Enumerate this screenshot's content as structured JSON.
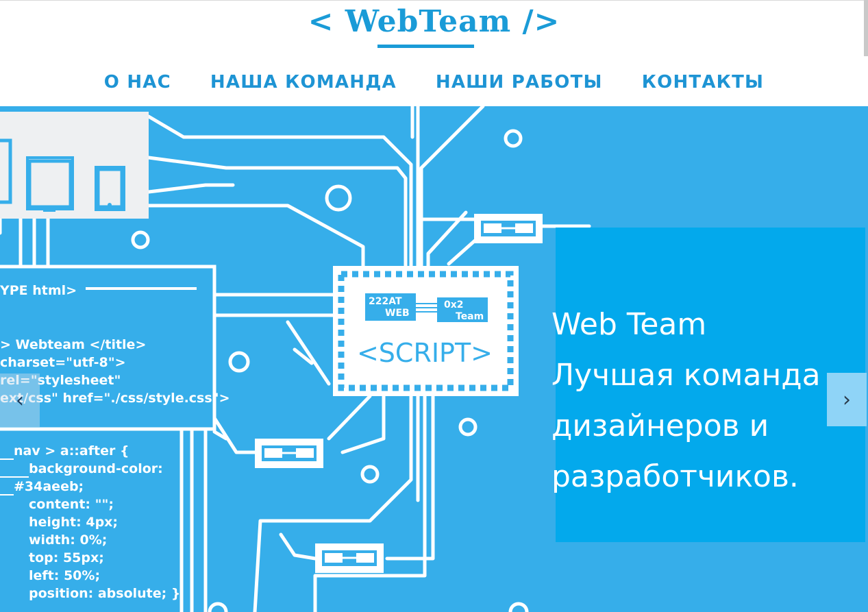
{
  "header": {
    "logo": "< WebTeam />",
    "nav": [
      "О НАС",
      "НАША КОМАНДА",
      "НАШИ РАБОТЫ",
      "КОНТАКТЫ"
    ]
  },
  "hero": {
    "illustration": {
      "chip": {
        "label1": "222AT",
        "label2": "WEB",
        "label3": "0x2",
        "label4": "Team",
        "script": "<SCRIPT>"
      },
      "code_top": [
        "YPE html>",
        "> Webteam </title>",
        "charset=\"utf-8\">",
        "rel=\"stylesheet\"",
        "ext/css\" href=\"./css/style.css\">"
      ],
      "code_bottom": [
        "nav > a::after {",
        "background-color:",
        "#34aeeb;",
        "content: \"\";",
        "height: 4px;",
        "width: 0%;",
        "top: 55px;",
        "left: 50%;",
        "position: absolute; }"
      ]
    },
    "caption": [
      "Web Team",
      "Лучшая команда",
      "дизайнеров и",
      "разработчиков."
    ],
    "prev_icon": "‹",
    "next_icon": "›"
  },
  "colors": {
    "brand": "#1a9bd7",
    "hero_bg": "#36aeea",
    "caption_bg": "#03a9ec"
  }
}
